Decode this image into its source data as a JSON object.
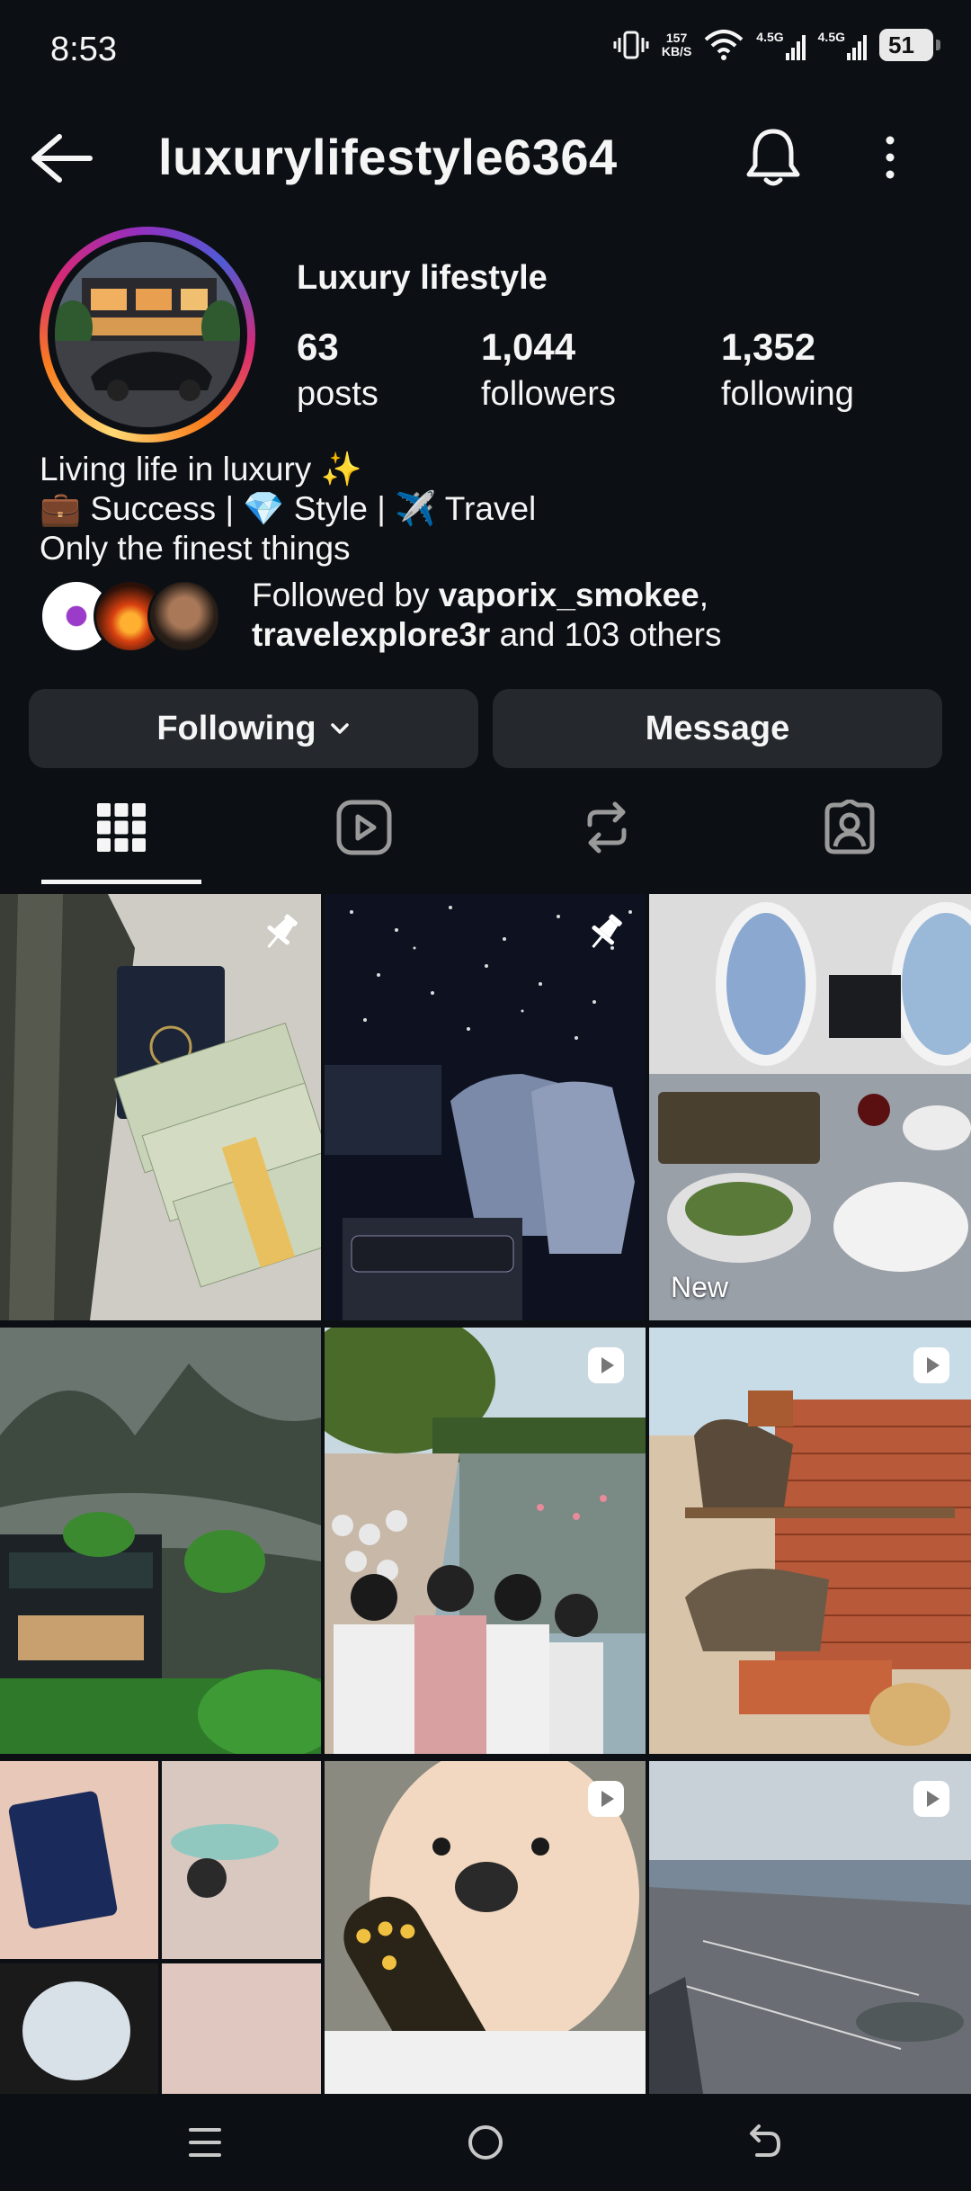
{
  "status_bar": {
    "time": "8:53",
    "net_speed_top": "157",
    "net_speed_bottom": "KB/S",
    "signal1": "4.5G",
    "signal2": "4.5G",
    "battery": "51"
  },
  "header": {
    "username": "luxurylifestyle6364"
  },
  "profile": {
    "display_name": "Luxury lifestyle",
    "posts_count": "63",
    "posts_label": "posts",
    "followers_count": "1,044",
    "followers_label": "followers",
    "following_count": "1,352",
    "following_label": "following"
  },
  "bio": {
    "line1": "Living life in luxury ✨",
    "line2": "💼 Success | 💎 Style | ✈️ Travel",
    "line3": "Only the finest things"
  },
  "followed_by": {
    "prefix": "Followed by ",
    "user1": "vaporix_smokee",
    "sep": ",",
    "user2": "travelexplore3r",
    "suffix": " and 103 others"
  },
  "actions": {
    "following_label": "Following",
    "message_label": "Message"
  },
  "grid": {
    "new_label": "New"
  },
  "colors": {
    "background": "#0c1014",
    "button": "#25292e",
    "text": "#f5f5f5"
  }
}
